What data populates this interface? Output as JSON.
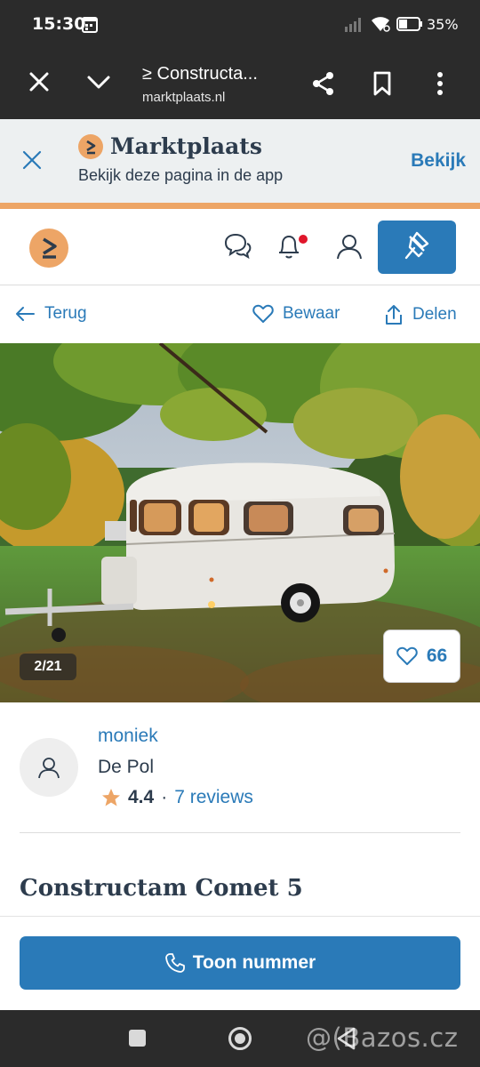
{
  "status_bar": {
    "time": "15:30",
    "battery": "35%",
    "icons": [
      "calendar-icon",
      "signal-icon",
      "wifi-icon",
      "battery-icon"
    ]
  },
  "browser": {
    "page_title": "≥ Constructa...",
    "url": "marktplaats.nl",
    "icons": [
      "close-icon",
      "chevron-down-icon",
      "share-icon",
      "bookmark-icon",
      "more-vert-icon"
    ]
  },
  "app_banner": {
    "brand": "Marktplaats",
    "subtitle": "Bekijk deze pagina in de app",
    "cta": "Bekijk",
    "logo_glyph": "≥"
  },
  "site_header": {
    "logo_glyph": "≥",
    "icons": [
      "chat-icon",
      "bell-icon",
      "user-icon",
      "pin-icon"
    ]
  },
  "actions": {
    "back": "Terug",
    "save": "Bewaar",
    "share": "Delen"
  },
  "gallery": {
    "counter": "2/21",
    "favorites": "66"
  },
  "seller": {
    "name": "moniek",
    "location": "De Pol",
    "rating": "4.4",
    "separator": "·",
    "reviews": "7 reviews"
  },
  "listing": {
    "title": "Constructam Comet 5"
  },
  "call": {
    "label": "Toon nummer"
  },
  "navigation": {
    "watermark": "@(Bazos.cz"
  },
  "colors": {
    "brand_blue": "#2a7ab8",
    "brand_orange": "#eda566",
    "text_dark": "#2d3c4d",
    "bar_dark": "#2b2b2b",
    "star": "#eda566",
    "notification": "#e0162b"
  }
}
